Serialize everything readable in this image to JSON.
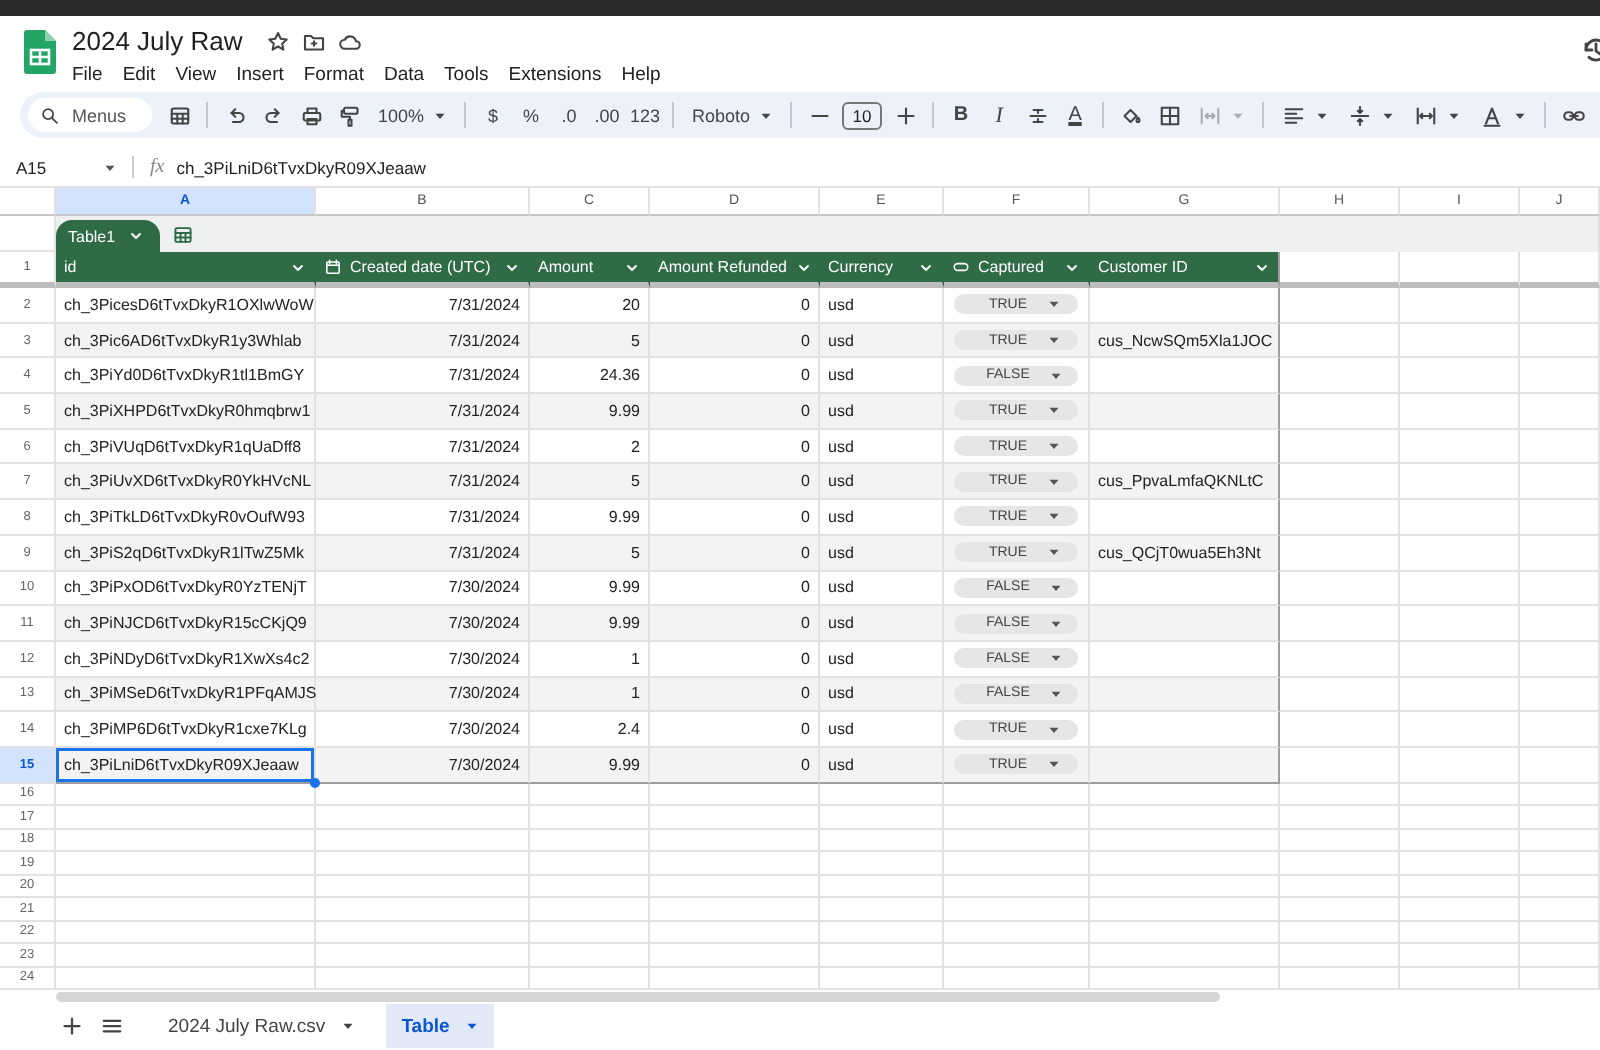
{
  "document": {
    "title": "2024 July Raw",
    "menu": [
      "File",
      "Edit",
      "View",
      "Insert",
      "Format",
      "Data",
      "Tools",
      "Extensions",
      "Help"
    ]
  },
  "toolbar": {
    "search_placeholder": "Menus",
    "zoom": "100%",
    "currency": "$",
    "percent": "%",
    "decrease_decimals": ".0",
    "increase_decimals": ".00",
    "number_format": "123",
    "font": "Roboto",
    "font_size": "10",
    "bold": "B",
    "italic": "I",
    "text_color": "A"
  },
  "formula_bar": {
    "cell_ref": "A15",
    "fx": "fx",
    "formula": "ch_3PiLniD6tTvxDkyR09XJeaaw"
  },
  "grid": {
    "column_letters": [
      "A",
      "B",
      "C",
      "D",
      "E",
      "F",
      "G",
      "H",
      "I",
      "J"
    ],
    "table": {
      "name": "Table1",
      "columns": [
        {
          "label": "id",
          "kind": "text"
        },
        {
          "label": "Created date (UTC)",
          "kind": "date"
        },
        {
          "label": "Amount",
          "kind": "number"
        },
        {
          "label": "Amount Refunded",
          "kind": "number"
        },
        {
          "label": "Currency",
          "kind": "text"
        },
        {
          "label": "Captured",
          "kind": "chip"
        },
        {
          "label": "Customer ID",
          "kind": "text"
        }
      ],
      "rows": [
        {
          "row_number": "2",
          "id": "ch_3PicesD6tTvxDkyR1OXlwWoW",
          "created_date": "7/31/2024",
          "amount": "20",
          "amount_refunded": "0",
          "currency": "usd",
          "captured": "TRUE",
          "selected": false
        },
        {
          "row_number": "3",
          "id": "ch_3Pic6AD6tTvxDkyR1y3Whlab",
          "created_date": "7/31/2024",
          "amount": "5",
          "amount_refunded": "0",
          "currency": "usd",
          "captured": "TRUE",
          "customer_id": "cus_NcwSQm5Xla1JOC",
          "selected": false
        },
        {
          "row_number": "4",
          "id": "ch_3PiYd0D6tTvxDkyR1tl1BmGY",
          "created_date": "7/31/2024",
          "amount": "24.36",
          "amount_refunded": "0",
          "currency": "usd",
          "captured": "FALSE",
          "selected": false
        },
        {
          "row_number": "5",
          "id": "ch_3PiXHPD6tTvxDkyR0hmqbrw1",
          "created_date": "7/31/2024",
          "amount": "9.99",
          "amount_refunded": "0",
          "currency": "usd",
          "captured": "TRUE",
          "selected": false
        },
        {
          "row_number": "6",
          "id": "ch_3PiVUqD6tTvxDkyR1qUaDff8",
          "created_date": "7/31/2024",
          "amount": "2",
          "amount_refunded": "0",
          "currency": "usd",
          "captured": "TRUE",
          "selected": false
        },
        {
          "row_number": "7",
          "id": "ch_3PiUvXD6tTvxDkyR0YkHVcNL",
          "created_date": "7/31/2024",
          "amount": "5",
          "amount_refunded": "0",
          "currency": "usd",
          "captured": "TRUE",
          "customer_id": "cus_PpvaLmfaQKNLtC",
          "selected": false
        },
        {
          "row_number": "8",
          "id": "ch_3PiTkLD6tTvxDkyR0vOufW93",
          "created_date": "7/31/2024",
          "amount": "9.99",
          "amount_refunded": "0",
          "currency": "usd",
          "captured": "TRUE",
          "selected": false
        },
        {
          "row_number": "9",
          "id": "ch_3PiS2qD6tTvxDkyR1lTwZ5Mk",
          "created_date": "7/31/2024",
          "amount": "5",
          "amount_refunded": "0",
          "currency": "usd",
          "captured": "TRUE",
          "customer_id": "cus_QCjT0wua5Eh3Nt",
          "selected": false
        },
        {
          "row_number": "10",
          "id": "ch_3PiPxOD6tTvxDkyR0YzTENjT",
          "created_date": "7/30/2024",
          "amount": "9.99",
          "amount_refunded": "0",
          "currency": "usd",
          "captured": "FALSE",
          "selected": false
        },
        {
          "row_number": "11",
          "id": "ch_3PiNJCD6tTvxDkyR15cCKjQ9",
          "created_date": "7/30/2024",
          "amount": "9.99",
          "amount_refunded": "0",
          "currency": "usd",
          "captured": "FALSE",
          "selected": false
        },
        {
          "row_number": "12",
          "id": "ch_3PiNDyD6tTvxDkyR1XwXs4c2",
          "created_date": "7/30/2024",
          "amount": "1",
          "amount_refunded": "0",
          "currency": "usd",
          "captured": "FALSE",
          "selected": false
        },
        {
          "row_number": "13",
          "id": "ch_3PiMSeD6tTvxDkyR1PFqAMJS",
          "created_date": "7/30/2024",
          "amount": "1",
          "amount_refunded": "0",
          "currency": "usd",
          "captured": "FALSE",
          "selected": false
        },
        {
          "row_number": "14",
          "id": "ch_3PiMP6D6tTvxDkyR1cxe7KLg",
          "created_date": "7/30/2024",
          "amount": "2.4",
          "amount_refunded": "0",
          "currency": "usd",
          "captured": "TRUE",
          "selected": false
        },
        {
          "row_number": "15",
          "id": "ch_3PiLniD6tTvxDkyR09XJeaaw",
          "created_date": "7/30/2024",
          "amount": "9.99",
          "amount_refunded": "0",
          "currency": "usd",
          "captured": "TRUE",
          "selected": true
        }
      ]
    },
    "header_row_number": "1",
    "empty_row_numbers": [
      "16",
      "17",
      "18",
      "19",
      "20",
      "21",
      "22",
      "23",
      "24"
    ]
  },
  "sheet_tabs": [
    {
      "label": "2024 July Raw.csv",
      "selected": false
    },
    {
      "label": "Table",
      "selected": true
    }
  ]
}
